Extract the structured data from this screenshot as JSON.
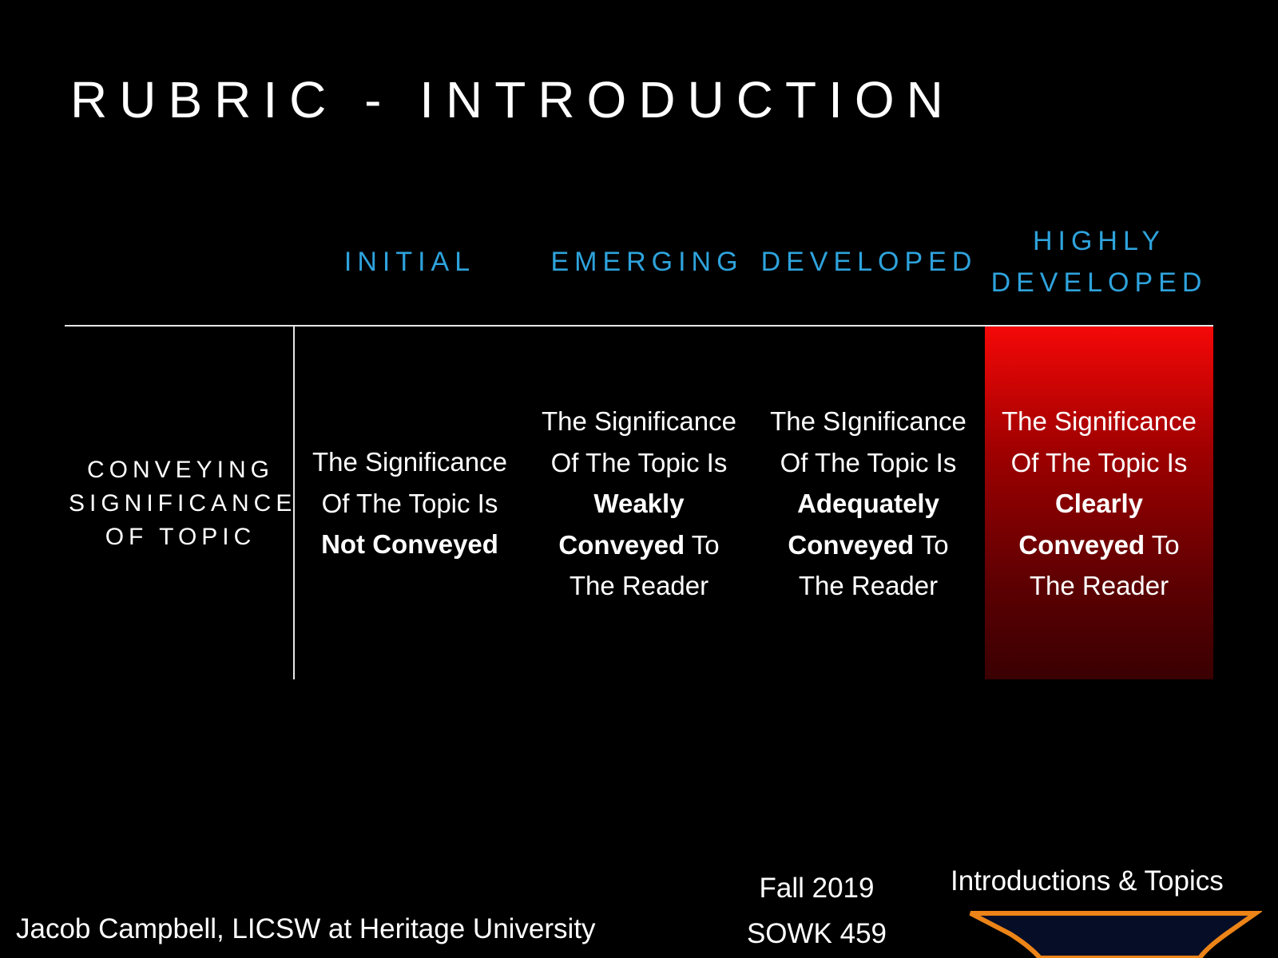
{
  "slide": {
    "title": "RUBRIC - INTRODUCTION",
    "accent_color": "#2ea3dc",
    "highlight_color": "#f50808",
    "columns": [
      {
        "label": "INITIAL"
      },
      {
        "label": "EMERGING"
      },
      {
        "label": "DEVELOPED"
      },
      {
        "label_line1": "HIGHLY",
        "label_line2": "DEVELOPED"
      }
    ],
    "row": {
      "label_line1": "CONVEYING",
      "label_line2": "SIGNIFICANCE",
      "label_line3": "OF TOPIC",
      "cells": [
        {
          "line1": "The Significance",
          "line2": "Of The Topic Is",
          "bold": "Not Conveyed",
          "rest": "",
          "line5": ""
        },
        {
          "line1": "The Significance",
          "line2": "Of The Topic Is",
          "bold1": "Weakly",
          "bold2": "Conveyed",
          "rest": " To",
          "line5": "The Reader"
        },
        {
          "line1": "The SIgnificance",
          "line2": "Of The Topic Is",
          "bold1": "Adequately",
          "bold2": "Conveyed",
          "rest": " To",
          "line5": "The Reader"
        },
        {
          "line1": "The Significance",
          "line2": "Of The Topic Is",
          "bold1": "Clearly",
          "bold2": "Conveyed",
          "rest": " To",
          "line5": "The Reader"
        }
      ]
    }
  },
  "footer": {
    "author": "Jacob Campbell, LICSW at Heritage University",
    "term": "Fall 2019",
    "course": "SOWK 459",
    "section": "Introductions & Topics",
    "emblem_icon": "pennant-emblem-icon"
  }
}
